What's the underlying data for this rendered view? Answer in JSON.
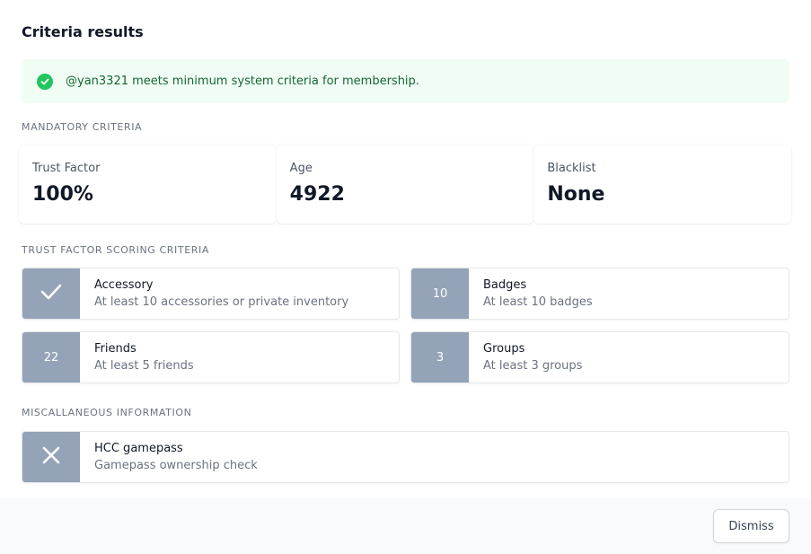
{
  "modal": {
    "title": "Criteria results",
    "alert": {
      "icon": "check-circle-icon",
      "text": "@yan3321 meets minimum system criteria for membership.",
      "color": "#22c55e"
    },
    "mandatory": {
      "label": "MANDATORY CRITERIA",
      "stats": [
        {
          "label": "Trust Factor",
          "value": "100%"
        },
        {
          "label": "Age",
          "value": "4922"
        },
        {
          "label": "Blacklist",
          "value": "None"
        }
      ]
    },
    "trust_factor": {
      "label": "TRUST FACTOR SCORING CRITERIA",
      "items": [
        {
          "badge": "",
          "badge_icon": "check-icon",
          "title": "Accessory",
          "desc": "At least 10 accessories or private inventory"
        },
        {
          "badge": "10",
          "title": "Badges",
          "desc": "At least 10 badges"
        },
        {
          "badge": "22",
          "title": "Friends",
          "desc": "At least 5 friends"
        },
        {
          "badge": "3",
          "title": "Groups",
          "desc": "At least 3 groups"
        }
      ]
    },
    "misc": {
      "label": "MISCALLANEOUS INFORMATION",
      "items": [
        {
          "badge": "",
          "badge_icon": "x-icon",
          "title": "HCC gamepass",
          "desc": "Gamepass ownership check"
        }
      ]
    },
    "dismiss_label": "Dismiss",
    "badge_color": "#94a3b8"
  }
}
